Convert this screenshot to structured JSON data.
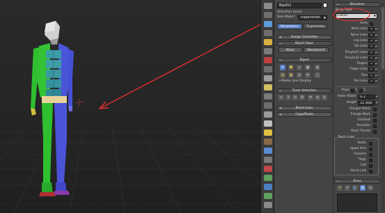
{
  "object_name": "Bip001",
  "object_color": "#f2f2f2",
  "selection_level": {
    "label": "Selection Level:",
    "sub_object_label": "Sub-Object",
    "sub_object_value": "Trajectories"
  },
  "tabs": {
    "parameters": "Parameters",
    "trajectories": "Trajectories"
  },
  "rollouts": {
    "assign_controller": "Assign Controller",
    "biped_apps": "Biped Apps",
    "biped": "Biped",
    "modes_and_display": "Modes and Display",
    "track_selection": "Track Selection",
    "bend_links": "Bend Links",
    "copy_paste": "Copy/Paste",
    "structure": "Structure",
    "twist_links": "Twist Links",
    "xtras": "Xtras"
  },
  "biped_apps_buttons": {
    "mixer": "Mixer",
    "workbench": "Workbench"
  },
  "body_type": {
    "label": "Body Type",
    "value": "Classic"
  },
  "structure_fields": [
    {
      "label": "Arms",
      "type": "checkbox"
    },
    {
      "label": "Neck Links",
      "value": "1"
    },
    {
      "label": "Spine Links",
      "value": "4"
    },
    {
      "label": "Leg Links",
      "value": "3"
    },
    {
      "label": "Tail Links",
      "value": "0"
    },
    {
      "label": "Ponytail1 Links",
      "value": "0"
    },
    {
      "label": "Ponytail2 Links",
      "value": "0"
    },
    {
      "label": "Fingers",
      "value": "1"
    },
    {
      "label": "Finger Links",
      "value": "1"
    },
    {
      "label": "Toes",
      "value": "1"
    },
    {
      "label": "Toe Links",
      "value": "1"
    }
  ],
  "props_label": "Props",
  "props_values": [
    "1",
    "2",
    "3"
  ],
  "ankle_attach": {
    "label": "Ankle Attach",
    "value": "0.2"
  },
  "height": {
    "label": "Height",
    "value": "31.988"
  },
  "checkbox_options": [
    "Triangle Pelvis",
    "Triangle Neck",
    "ForeFeet",
    "Knuckles",
    "Short Thumb"
  ],
  "twist_fields": [
    "Twists",
    "Upper Arm",
    "Forearm",
    "Thigh",
    "Calf",
    "Horse Link"
  ],
  "annotation_color": "#e03030"
}
